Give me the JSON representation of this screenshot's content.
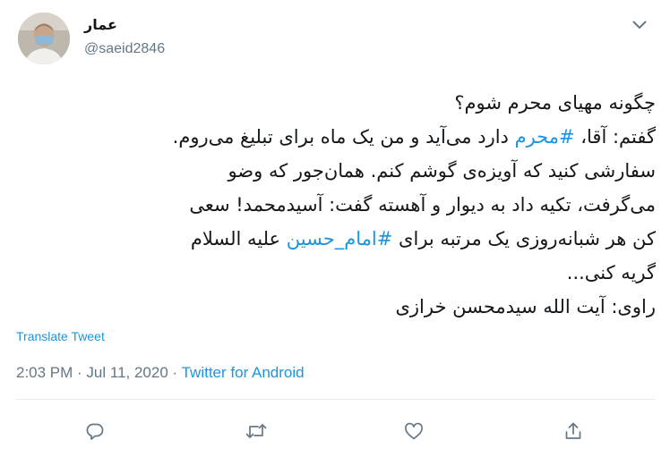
{
  "user": {
    "display_name": "عمار",
    "handle": "@saeid2846"
  },
  "tweet": {
    "line1": "چگونه مهیای محرم شوم؟",
    "line2_a": "گفتم: آقا، ",
    "line2_hashtag": "#محرم",
    "line2_b": " دارد می‌آید و من یک ماه برای تبلیغ می‌روم.",
    "line3": "سفارشی کنید که آویزه‌ی گوشم کنم. همان‌جور که وضو",
    "line4": "می‌گرفت، تکیه داد به دیوار و آهسته گفت: آسیدمحمد! سعی",
    "line5_a": "کن هر شبانه‌روزی یک مرتبه برای ",
    "line5_hashtag": "#امام_حسین",
    "line5_b": " علیه السلام",
    "line6": "گریه کنی...",
    "line7": "راوی: آیت الله سیدمحسن خرازی"
  },
  "translate_label": "Translate Tweet",
  "meta": {
    "time": "2:03 PM",
    "sep1": " · ",
    "date": "Jul 11, 2020",
    "sep2": " · ",
    "source": "Twitter for Android"
  },
  "icons": {
    "caret": "chevron-down-icon",
    "reply": "reply-icon",
    "retweet": "retweet-icon",
    "like": "heart-icon",
    "share": "share-icon"
  },
  "colors": {
    "accent": "#1b95e0",
    "muted": "#657786",
    "text": "#14171a",
    "divider": "#e6ecf0"
  }
}
